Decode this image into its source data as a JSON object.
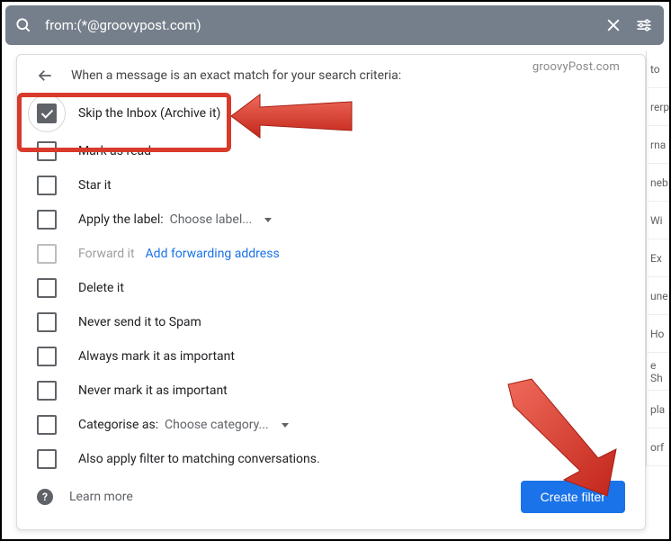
{
  "search": {
    "query": "from:(*@groovypost.com)"
  },
  "watermark": "groovyPost.com",
  "header": "When a message is an exact match for your search criteria:",
  "opts": {
    "skip": "Skip the Inbox (Archive it)",
    "read": "Mark as read",
    "star": "Star it",
    "label_pre": "Apply the label:  ",
    "label_dd": "Choose label...",
    "fwd": "Forward it",
    "fwd_link": "Add forwarding address",
    "del": "Delete it",
    "nospam": "Never send it to Spam",
    "alw_imp": "Always mark it as important",
    "nev_imp": "Never mark it as important",
    "cat_pre": "Categorise as:  ",
    "cat_dd": "Choose category...",
    "also": "Also apply filter to matching conversations."
  },
  "footer": {
    "learn": "Learn more",
    "btn": "Create filter"
  },
  "side": [
    "to",
    "rerp",
    "rna",
    "neb",
    "Wi",
    "Ex",
    "une",
    "Ho",
    "e Sh",
    "pla",
    "orf"
  ]
}
